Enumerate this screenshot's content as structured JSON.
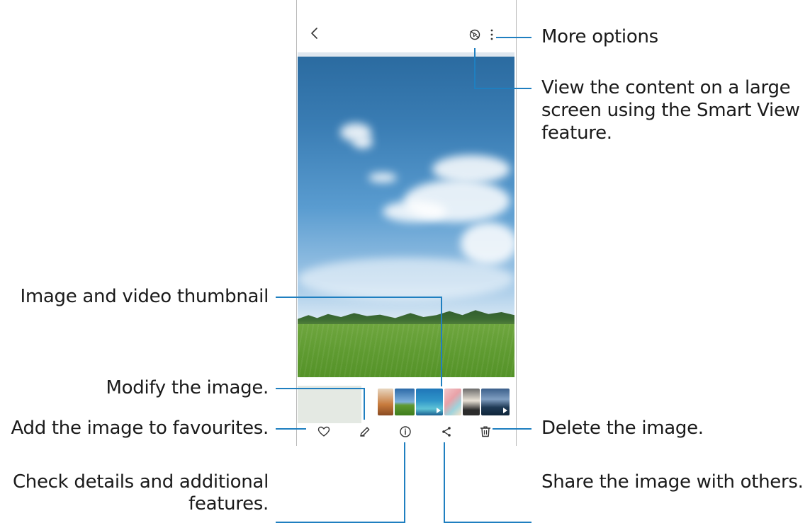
{
  "callouts": {
    "more_options": "More options",
    "smart_view_1": "View the content on a large",
    "smart_view_2": "screen using the Smart View",
    "smart_view_3": "feature.",
    "thumbnail": "Image and video thumbnail",
    "modify": "Modify the image.",
    "favourites": "Add the image to favourites.",
    "delete": "Delete the image.",
    "details_1": "Check details and additional",
    "details_2": "features.",
    "share": "Share the image with others."
  },
  "icons": {
    "back": "chevron-left-icon",
    "smart_view": "smart-view-icon",
    "more": "more-vertical-icon",
    "favourite": "heart-icon",
    "edit": "pencil-icon",
    "details": "info-icon",
    "share": "share-icon",
    "delete": "trash-icon"
  },
  "colors": {
    "callout_line": "#1f7fc0",
    "phone_border": "#b9b9b9"
  }
}
